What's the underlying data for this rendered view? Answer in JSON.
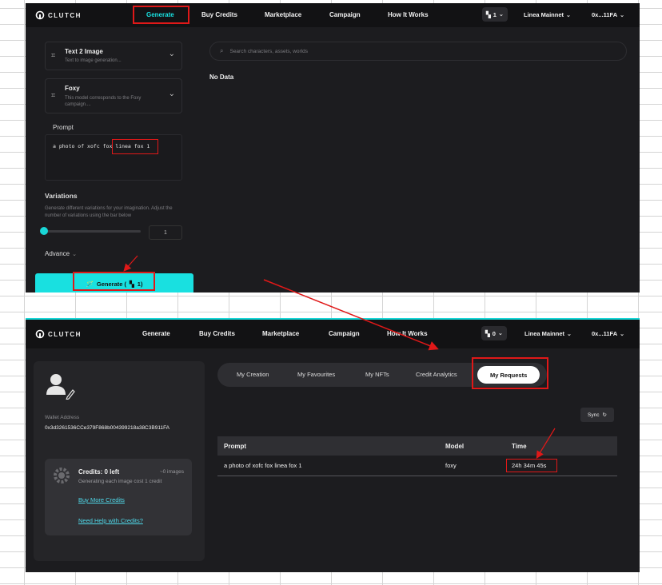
{
  "top": {
    "brand": "CLUTCH",
    "nav": [
      "Generate",
      "Buy Credits",
      "Marketplace",
      "Campaign",
      "How It Works"
    ],
    "credit_count": "1",
    "network": "Linea Mainnet",
    "wallet": "0x...11FA",
    "models": [
      {
        "title": "Text 2 Image",
        "subtitle": "Text to image generation..."
      },
      {
        "title": "Foxy",
        "subtitle": "This model corresponds to the Foxy campaign...."
      }
    ],
    "prompt_label": "Prompt",
    "prompt_prefix": "a photo of xofc fox",
    "prompt_highlight": "linea fox 1",
    "variations_label": "Variations",
    "variations_desc": "Generate different variations for your imagination. Adjust the number of variations using the bar below",
    "variations_value": "1",
    "advance_label": "Advance",
    "generate_button": "Generate (",
    "generate_cost": "1)",
    "search_placeholder": "Search characters, assets, worlds",
    "no_data": "No Data",
    "variations_fraction": 0
  },
  "bottom": {
    "brand": "CLUTCH",
    "nav": [
      "Generate",
      "Buy Credits",
      "Marketplace",
      "Campaign",
      "How It Works"
    ],
    "credit_count": "0",
    "network": "Linea Mainnet",
    "wallet": "0x...11FA",
    "wallet_label": "Wallet Address",
    "wallet_address": "0x3d3261536CCe379F868b004399218a38C3B911FA",
    "credits_title": "Credits: 0 left",
    "credits_images": "~0 images",
    "credits_desc": "Generating each image cost 1 credit",
    "buy_more": "Buy More Credits",
    "need_help": "Need Help with Credits?",
    "tabs": [
      "My Creation",
      "My Favourites",
      "My NFTs",
      "Credit Analytics",
      "My Requests"
    ],
    "sync": "Sync",
    "columns": [
      "Prompt",
      "Model",
      "Time"
    ],
    "rows": [
      {
        "prompt": "a photo of xofc fox linea fox 1",
        "model": "foxy",
        "time": "24h 34m 45s"
      }
    ]
  },
  "colors": {
    "accent": "#19e0e0",
    "annotation": "#e01818",
    "background": "#1c1c1f"
  }
}
